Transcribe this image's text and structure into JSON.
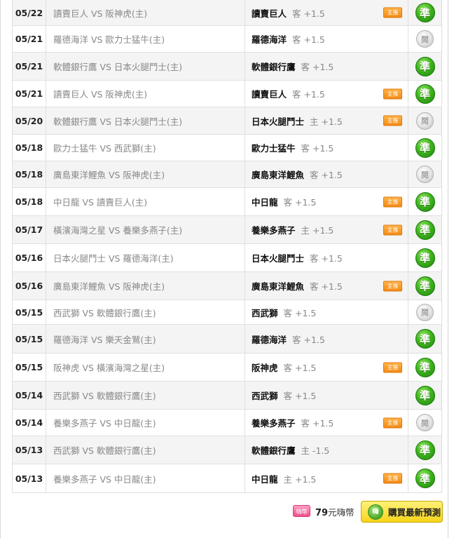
{
  "rows": [
    {
      "date": "05/22",
      "match": "讀賣巨人 VS 阪神虎(主)",
      "team": "讀賣巨人",
      "line": "客 +1.5",
      "tag": true,
      "result": "準",
      "hit": true
    },
    {
      "date": "05/21",
      "match": "羅德海洋 VS 歐力士猛牛(主)",
      "team": "羅德海洋",
      "line": "客 +1.5",
      "tag": false,
      "result": "閱",
      "hit": false
    },
    {
      "date": "05/21",
      "match": "軟體銀行鷹 VS 日本火腿鬥士(主)",
      "team": "軟體銀行鷹",
      "line": "客 +1.5",
      "tag": false,
      "result": "準",
      "hit": true
    },
    {
      "date": "05/21",
      "match": "讀賣巨人 VS 阪神虎(主)",
      "team": "讀賣巨人",
      "line": "客 +1.5",
      "tag": true,
      "result": "準",
      "hit": true
    },
    {
      "date": "05/20",
      "match": "軟體銀行鷹 VS 日本火腿鬥士(主)",
      "team": "日本火腿鬥士",
      "line": "主 +1.5",
      "tag": true,
      "result": "閱",
      "hit": false
    },
    {
      "date": "05/18",
      "match": "歐力士猛牛 VS 西武獅(主)",
      "team": "歐力士猛牛",
      "line": "客 +1.5",
      "tag": false,
      "result": "準",
      "hit": true
    },
    {
      "date": "05/18",
      "match": "廣島東洋鯉魚 VS 阪神虎(主)",
      "team": "廣島東洋鯉魚",
      "line": "客 +1.5",
      "tag": false,
      "result": "閱",
      "hit": false
    },
    {
      "date": "05/18",
      "match": "中日龍 VS 讀賣巨人(主)",
      "team": "中日龍",
      "line": "客 +1.5",
      "tag": true,
      "result": "準",
      "hit": true
    },
    {
      "date": "05/17",
      "match": "橫濱海灣之星 VS 養樂多燕子(主)",
      "team": "養樂多燕子",
      "line": "主 +1.5",
      "tag": true,
      "result": "準",
      "hit": true
    },
    {
      "date": "05/16",
      "match": "日本火腿鬥士 VS 羅德海洋(主)",
      "team": "日本火腿鬥士",
      "line": "客 +1.5",
      "tag": false,
      "result": "準",
      "hit": true
    },
    {
      "date": "05/16",
      "match": "廣島東洋鯉魚 VS 阪神虎(主)",
      "team": "廣島東洋鯉魚",
      "line": "客 +1.5",
      "tag": true,
      "result": "準",
      "hit": true
    },
    {
      "date": "05/15",
      "match": "西武獅 VS 軟體銀行鷹(主)",
      "team": "西武獅",
      "line": "客 +1.5",
      "tag": false,
      "result": "閱",
      "hit": false
    },
    {
      "date": "05/15",
      "match": "羅德海洋 VS 樂天金鷲(主)",
      "team": "羅德海洋",
      "line": "客 +1.5",
      "tag": false,
      "result": "準",
      "hit": true
    },
    {
      "date": "05/15",
      "match": "阪神虎 VS 橫濱海灣之星(主)",
      "team": "阪神虎",
      "line": "客 +1.5",
      "tag": true,
      "result": "準",
      "hit": true
    },
    {
      "date": "05/14",
      "match": "西武獅 VS 軟體銀行鷹(主)",
      "team": "西武獅",
      "line": "客 +1.5",
      "tag": false,
      "result": "準",
      "hit": true
    },
    {
      "date": "05/14",
      "match": "養樂多燕子 VS 中日龍(主)",
      "team": "養樂多燕子",
      "line": "客 +1.5",
      "tag": true,
      "result": "閱",
      "hit": false
    },
    {
      "date": "05/13",
      "match": "西武獅 VS 軟體銀行鷹(主)",
      "team": "軟體銀行鷹",
      "line": "主 -1.5",
      "tag": false,
      "result": "準",
      "hit": true
    },
    {
      "date": "05/13",
      "match": "養樂多燕子 VS 中日龍(主)",
      "team": "中日龍",
      "line": "主 +1.5",
      "tag": true,
      "result": "準",
      "hit": true
    }
  ],
  "tag_label": "主推",
  "footer": {
    "coin_label": "嗨幣",
    "price_value": "79",
    "price_unit": "元嗨幣",
    "buy_icon": "嗨",
    "buy_label": "購買最新預測"
  }
}
